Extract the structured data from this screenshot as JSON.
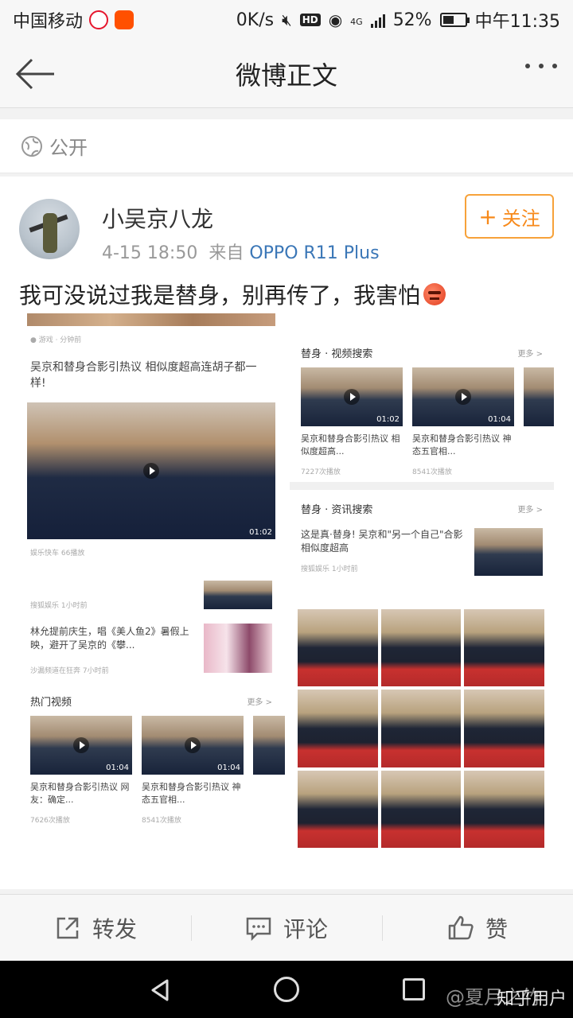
{
  "status_bar": {
    "carrier": "中国移动",
    "speed": "0K/s",
    "hd": "HD",
    "network": "4G",
    "battery": "52%",
    "battery_level": 0.52,
    "time": "中午11:35"
  },
  "nav": {
    "title": "微博正文"
  },
  "visibility": {
    "label": "公开"
  },
  "post": {
    "username": "小吴京八龙",
    "time": "4-15 18:50",
    "source_prefix": "来自",
    "device": "OPPO R11 Plus",
    "follow_label": "关注",
    "text": "我可没说过我是替身，别再传了，我害怕",
    "emoji": "angry-emoji"
  },
  "collage": {
    "article_title": "吴京和替身合影引热议 相似度超高连胡子都一样!",
    "article_source": "娱乐快车  66播放",
    "video_section": "替身 · 视频搜索",
    "more": "更多 >",
    "videos": [
      {
        "title": "吴京和替身合影引热议 相似度超高...",
        "views": "7227次播放",
        "duration": "01:02"
      },
      {
        "title": "吴京和替身合影引热议 神态五官相...",
        "views": "8541次播放",
        "duration": "01:04"
      }
    ],
    "news_section": "替身 · 资讯搜索",
    "news_title": "这是真·替身! 吴京和\"另一个自己\"合影相似度超高",
    "news_source": "搜狐娱乐  1小时前",
    "news2_source": "搜狐娱乐  1小时前",
    "news3_title": "林允提前庆生，唱《美人鱼2》暑假上映，避开了吴京的《攀...",
    "news3_source": "沙漏频道在狂奔  7小时前",
    "hot_section": "热门视频",
    "hot_videos": [
      {
        "title": "吴京和替身合影引热议 网友：确定...",
        "views": "7626次播放",
        "duration": "01:04"
      },
      {
        "title": "吴京和替身合影引热议 神态五官相...",
        "views": "8541次播放",
        "duration": "01:04"
      }
    ]
  },
  "actions": [
    {
      "label": "转发",
      "icon": "share-icon"
    },
    {
      "label": "评论",
      "icon": "comment-icon"
    },
    {
      "label": "赞",
      "icon": "like-icon"
    }
  ],
  "watermark": "知乎用户",
  "watermark_weibo": "@夏月之竹"
}
